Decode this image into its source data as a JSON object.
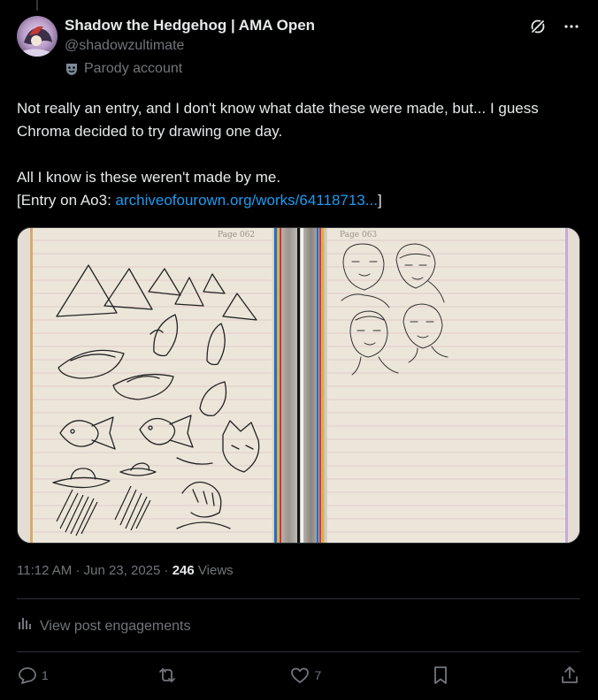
{
  "post": {
    "display_name": "Shadow the Hedgehog | AMA Open",
    "handle": "@shadowzultimate",
    "account_label": "Parody account",
    "text_line1": "Not really an entry, and I don't know what date these were made, but... I guess Chroma decided to try drawing one day.",
    "text_line2": "All I know is these weren't made by me.",
    "text_prefix": "[Entry on Ao3: ",
    "link_text": "archiveofourown.org/works/64118713...",
    "text_suffix": "]",
    "time": "11:12 AM",
    "date": "Jun 23, 2025",
    "separator": "·",
    "views_count": "246",
    "views_label": "Views"
  },
  "media": {
    "left_page_label": "Page 062",
    "right_page_label": "Page 063"
  },
  "engagements_label": "View post engagements",
  "actions": {
    "reply_count": "1",
    "repost_count": "",
    "like_count": "7"
  },
  "colors": {
    "background": "#000000",
    "text": "#e7e9ea",
    "muted": "#71767b",
    "link": "#1d9bf0",
    "divider": "#2f3336",
    "paper": "#ece6da"
  },
  "icons": {
    "header_left": "grok-icon",
    "header_right": "more-icon",
    "account_label": "parody-mask-icon"
  }
}
